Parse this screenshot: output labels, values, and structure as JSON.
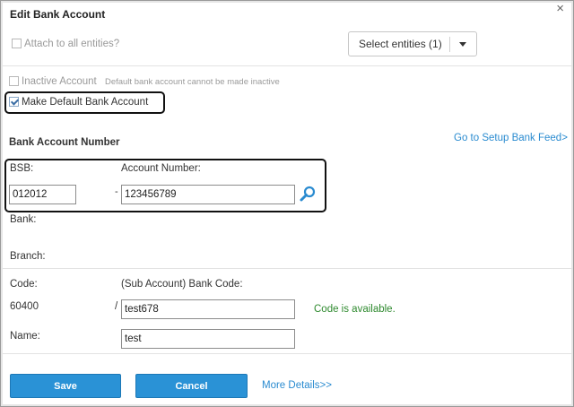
{
  "dialog": {
    "title": "Edit Bank Account",
    "close_glyph": "×"
  },
  "attach": {
    "label": "Attach to all entities?",
    "checked": false
  },
  "entities_select": {
    "label": "Select entities (1)",
    "icon": "caret-down-icon"
  },
  "inactive": {
    "label": "Inactive Account",
    "note": "Default bank account cannot be made inactive",
    "checked": false
  },
  "make_default": {
    "label": "Make Default Bank Account",
    "checked": true
  },
  "section": {
    "title": "Bank Account Number",
    "setup_link": "Go to Setup Bank Feed>"
  },
  "bsb": {
    "label": "BSB:",
    "value": "012012"
  },
  "dash": "-",
  "account_number": {
    "label": "Account Number:",
    "value": "123456789",
    "icon": "search-icon"
  },
  "bank": {
    "label": "Bank:"
  },
  "branch": {
    "label": "Branch:"
  },
  "code": {
    "label": "Code:",
    "value": "60400",
    "slash": "/"
  },
  "sub_code": {
    "label": "(Sub Account) Bank Code:",
    "value": "test678",
    "status": "Code is available."
  },
  "name": {
    "label": "Name:",
    "value": "test"
  },
  "footer": {
    "save": "Save",
    "cancel": "Cancel",
    "more": "More Details>>"
  },
  "colors": {
    "primary": "#2a92d6",
    "link": "#2a8bd0",
    "success": "#2f8a2f"
  }
}
